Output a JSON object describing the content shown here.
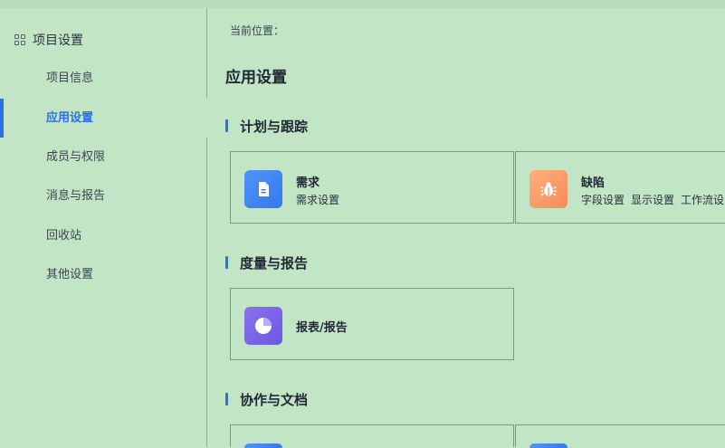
{
  "sidebar": {
    "group_label": "项目设置",
    "items": [
      {
        "label": "项目信息"
      },
      {
        "label": "应用设置"
      },
      {
        "label": "成员与权限"
      },
      {
        "label": "消息与报告"
      },
      {
        "label": "回收站"
      },
      {
        "label": "其他设置"
      }
    ],
    "active_index": 1
  },
  "breadcrumb": "当前位置：",
  "page_title": "应用设置",
  "sections": [
    {
      "title": "计划与跟踪",
      "cards": [
        {
          "title": "需求",
          "icon": "document-icon",
          "links": [
            "需求设置"
          ]
        },
        {
          "title": "缺陷",
          "icon": "bug-icon",
          "links": [
            "字段设置",
            "显示设置",
            "工作流设"
          ]
        }
      ]
    },
    {
      "title": "度量与报告",
      "cards": [
        {
          "title": "报表/报告",
          "icon": "pie-chart-icon",
          "links": []
        }
      ]
    },
    {
      "title": "协作与文档",
      "cards": []
    }
  ],
  "colors": {
    "background": "#c2e5c6",
    "accent": "#2f6fe4",
    "blue_icon": "#3677ee",
    "orange_icon": "#f48b5c",
    "purple_icon": "#6c57e2"
  }
}
